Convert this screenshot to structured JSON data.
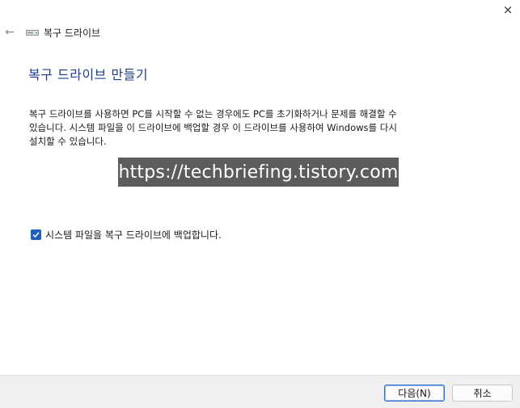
{
  "window": {
    "title": "복구 드라이브",
    "close_icon": "×"
  },
  "nav": {
    "back_icon": "←"
  },
  "page": {
    "heading": "복구 드라이브 만들기",
    "description_lines": [
      "복구 드라이브를 사용하면 PC를 시작할 수 없는 경우에도 PC를 초기화하거나 문제를 해결할 수",
      "있습니다. 시스템 파일을 이 드라이브에 백업할 경우 이 드라이브를 사용하여 Windows를 다시",
      "설치할 수 있습니다."
    ],
    "watermark": "https://techbriefing.tistory.com",
    "backup_checkbox": {
      "label": "시스템 파일을 복구 드라이브에 백업합니다.",
      "checked": true
    }
  },
  "footer": {
    "next_label": "다음(N)",
    "cancel_label": "취소"
  },
  "colors": {
    "accent": "#1f5fbf",
    "heading": "#1c3c8a",
    "watermark_bg": "#5c5c5c"
  }
}
